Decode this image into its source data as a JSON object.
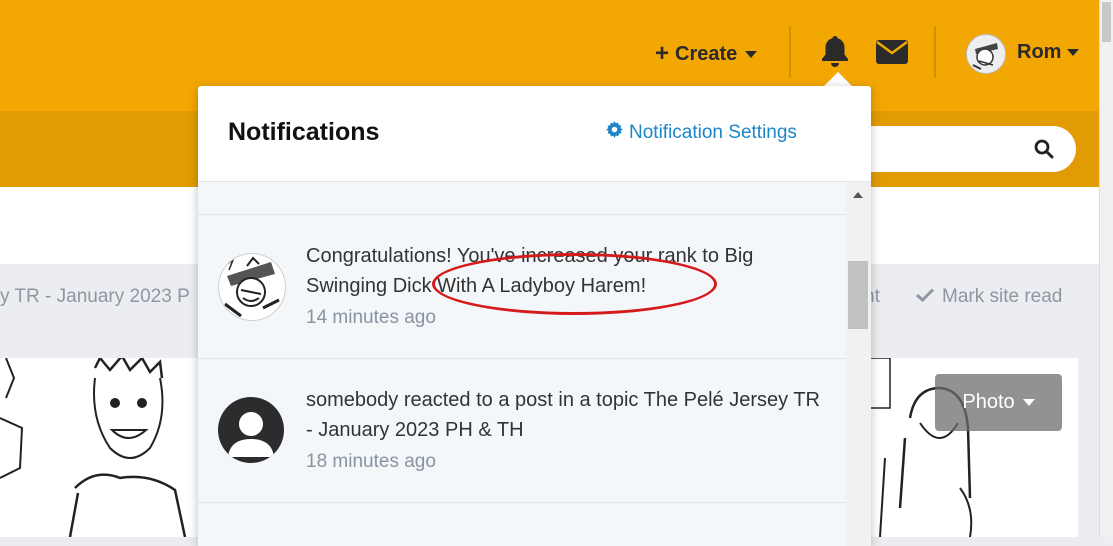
{
  "header": {
    "create_label": "Create",
    "user_name": "Rom",
    "icons": [
      "plus-icon",
      "bell-icon",
      "envelope-icon",
      "search-icon",
      "gear-icon",
      "check-icon"
    ]
  },
  "breadcrumb": {
    "left_text": "y TR - January 2023 P",
    "right_fragment": "nt",
    "mark_site_read": "Mark site read"
  },
  "photo_button": {
    "label": "Photo"
  },
  "notifications": {
    "title": "Notifications",
    "settings_label": "Notification Settings",
    "items": [
      {
        "text": "Congratulations! You've increased your rank to Big Swinging Dick With A Ladyboy Harem!",
        "time": "14 minutes ago"
      },
      {
        "text": "somebody reacted to a post in a topic The Pelé Jersey TR - January 2023 PH & TH",
        "time": "18 minutes ago"
      }
    ]
  },
  "colors": {
    "header_bg": "#f3a703",
    "subbar_bg": "#e29b04",
    "link_blue": "#1d86c8",
    "annotation_red": "#d41a1a"
  }
}
